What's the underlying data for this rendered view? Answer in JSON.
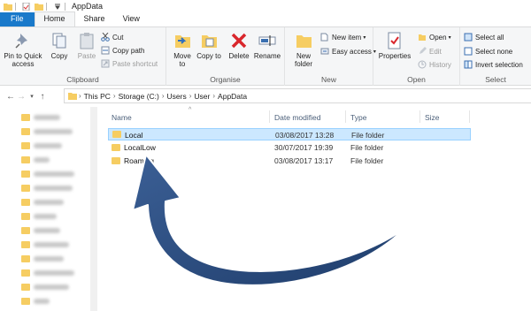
{
  "window": {
    "title": "AppData"
  },
  "tabs": [
    {
      "label": "File"
    },
    {
      "label": "Home"
    },
    {
      "label": "Share"
    },
    {
      "label": "View"
    }
  ],
  "ribbon": {
    "clipboard": {
      "label": "Clipboard",
      "pin_label": "Pin to Quick access",
      "copy_label": "Copy",
      "paste_label": "Paste",
      "cut_label": "Cut",
      "copy_path_label": "Copy path",
      "paste_shortcut_label": "Paste shortcut"
    },
    "organise": {
      "label": "Organise",
      "move_to_label": "Move to",
      "copy_to_label": "Copy to",
      "delete_label": "Delete",
      "rename_label": "Rename"
    },
    "new": {
      "label": "New",
      "new_folder_label": "New folder",
      "new_item_label": "New item",
      "easy_access_label": "Easy access"
    },
    "open": {
      "label": "Open",
      "properties_label": "Properties",
      "open_label": "Open",
      "edit_label": "Edit",
      "history_label": "History"
    },
    "select": {
      "label": "Select",
      "select_all_label": "Select all",
      "select_none_label": "Select none",
      "invert_label": "Invert selection"
    }
  },
  "address": {
    "crumbs": [
      "This PC",
      "Storage (C:)",
      "Users",
      "User",
      "AppData"
    ]
  },
  "columns": {
    "name": "Name",
    "date": "Date modified",
    "type": "Type",
    "size": "Size"
  },
  "files": [
    {
      "name": "Local",
      "date": "03/08/2017 13:28",
      "type": "File folder"
    },
    {
      "name": "LocalLow",
      "date": "30/07/2017 19:39",
      "type": "File folder"
    },
    {
      "name": "Roaming",
      "date": "03/08/2017 13:17",
      "type": "File folder"
    }
  ],
  "colors": {
    "file_tab": "#1979ca",
    "selection": "#cce8ff",
    "folder": "#f6cd62",
    "arrow": "#2c4d80"
  },
  "icons": [
    "back-arrow-icon",
    "forward-arrow-icon",
    "up-arrow-icon",
    "folder-icon",
    "pin-icon",
    "copy-icon",
    "paste-icon",
    "scissors-icon",
    "delete-icon",
    "rename-icon",
    "properties-icon"
  ]
}
